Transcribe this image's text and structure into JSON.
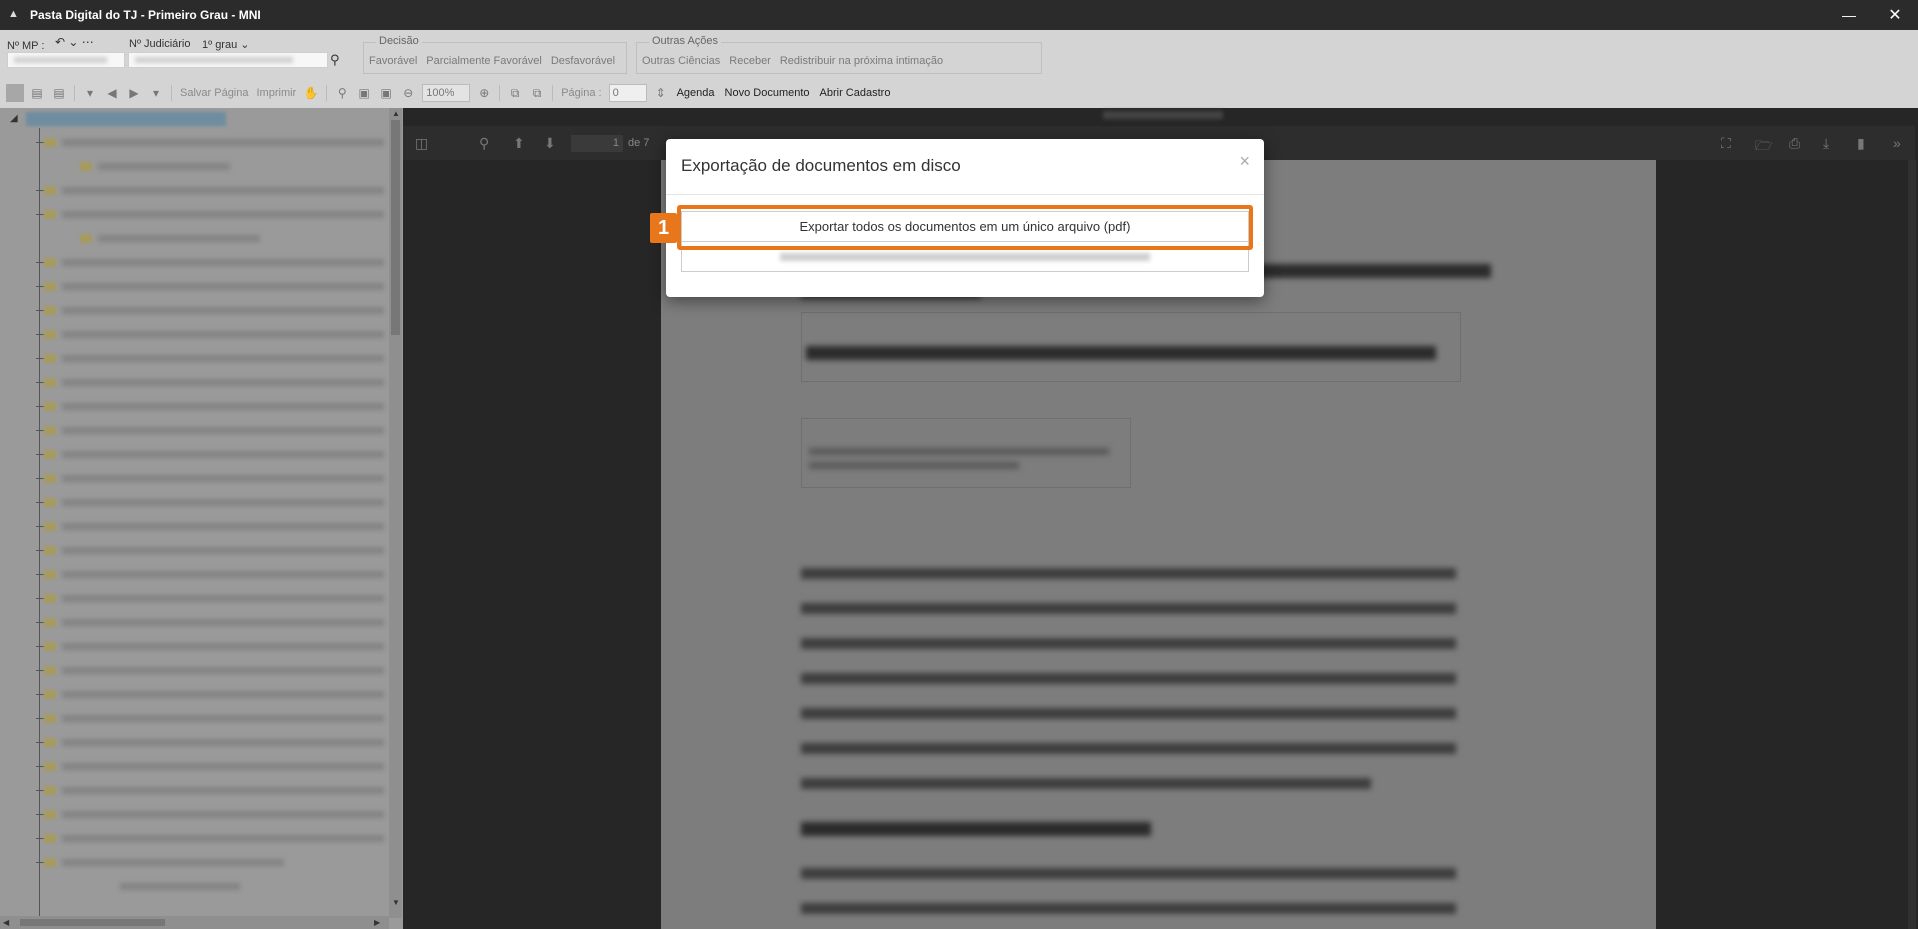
{
  "window": {
    "title": "Pasta Digital do TJ - Primeiro Grau - MNI",
    "minimize_icon": "minimize-icon",
    "close_icon": "close-icon"
  },
  "header": {
    "mp_label": "Nº MP :",
    "judicial_label": "Nº Judiciário",
    "grau_value": "1º grau",
    "decision_group": {
      "title": "Decisão",
      "items": [
        "Favorável",
        "Parcialmente Favorável",
        "Desfavorável"
      ]
    },
    "other_actions_group": {
      "title": "Outras Ações",
      "items": [
        "Outras Ciências",
        "Receber",
        "Redistribuir na próxima intimação"
      ]
    }
  },
  "toolbar": {
    "save_page": "Salvar Página",
    "print": "Imprimir",
    "zoom": "100%",
    "page_label": "Página :",
    "page_value": "0",
    "agenda": "Agenda",
    "new_document": "Novo Documento",
    "open_registry": "Abrir Cadastro"
  },
  "pdf_viewer": {
    "page_number": "1",
    "page_of": "de 7"
  },
  "modal": {
    "title": "Exportação de documentos em disco",
    "close_symbol": "×",
    "export_single_pdf": "Exportar todos os documentos em um único arquivo (pdf)"
  },
  "annotation": {
    "step_number": "1",
    "accent_color": "#e8771b"
  }
}
